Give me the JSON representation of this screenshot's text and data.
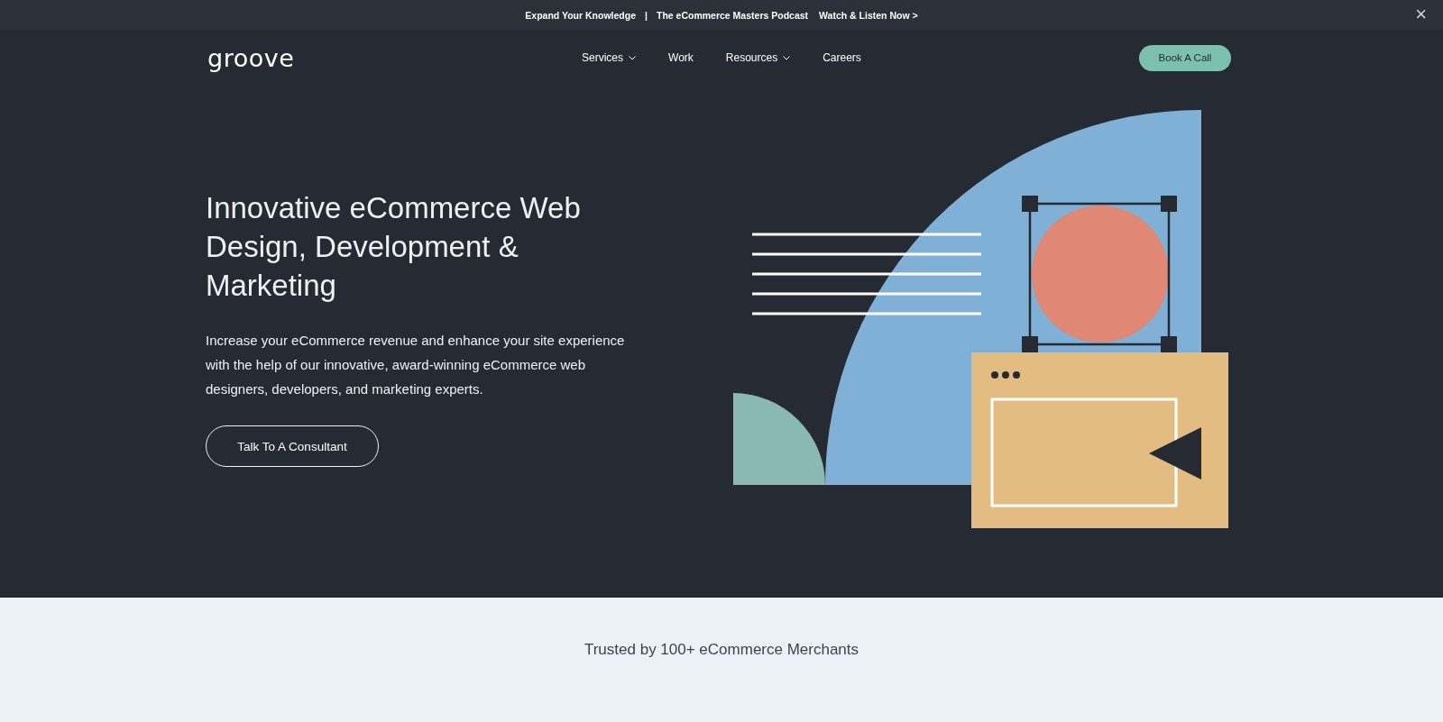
{
  "announcement": {
    "items": [
      "Expand Your Knowledge",
      "|",
      "The eCommerce Masters Podcast",
      "Watch & Listen Now >"
    ],
    "close": "×"
  },
  "nav": {
    "logo": "groove",
    "links": [
      {
        "label": "Services",
        "dropdown": true
      },
      {
        "label": "Work",
        "dropdown": false
      },
      {
        "label": "Resources",
        "dropdown": true
      },
      {
        "label": "Careers",
        "dropdown": false
      }
    ],
    "cta": "Book A Call"
  },
  "hero": {
    "heading": "Innovative eCommerce Web Design, Development & Marketing",
    "text": "Increase your eCommerce revenue and enhance your site experience with the help of our innovative, award-winning eCommerce web designers, developers, and marketing experts.",
    "button": "Talk To A Consultant"
  },
  "trusted": {
    "text": "Trusted by 100+ eCommerce Merchants"
  }
}
